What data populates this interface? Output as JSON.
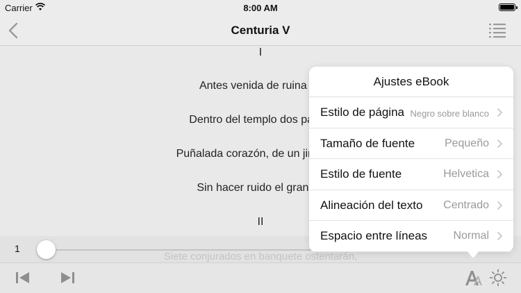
{
  "status": {
    "carrier": "Carrier",
    "time": "8:00 AM",
    "battery_level": 1.0
  },
  "nav": {
    "title": "Centuria V",
    "back_icon": "chevron-left-icon",
    "toc_icon": "list-icon"
  },
  "content": {
    "lines": [
      "I",
      "Antes venida de ruina cé",
      "Dentro del templo dos parlan",
      "Puñalada corazón, de un jinete en",
      "Sin hacer ruido el gran en",
      "II"
    ]
  },
  "slider": {
    "page": "1",
    "progress": 0.0,
    "preview_text": "Siete conjurados en banquete ostentarán,"
  },
  "popover": {
    "title": "Ajustes eBook",
    "rows": [
      {
        "label": "Estilo de página",
        "value": "Negro sobre blanco"
      },
      {
        "label": "Tamaño de fuente",
        "value": "Pequeño"
      },
      {
        "label": "Estilo de fuente",
        "value": "Helvetica"
      },
      {
        "label": "Alineación del texto",
        "value": "Centrado"
      },
      {
        "label": "Espacio entre líneas",
        "value": "Normal"
      }
    ]
  },
  "toolbar": {
    "prev_icon": "skip-back-icon",
    "next_icon": "skip-forward-icon",
    "font_icon": "font-settings-icon",
    "brightness_icon": "brightness-icon"
  },
  "colors": {
    "background": "#e9e9e9",
    "popover": "#ffffff",
    "value_text": "#9a9a9a",
    "icon_gray": "#8e8e8e"
  }
}
